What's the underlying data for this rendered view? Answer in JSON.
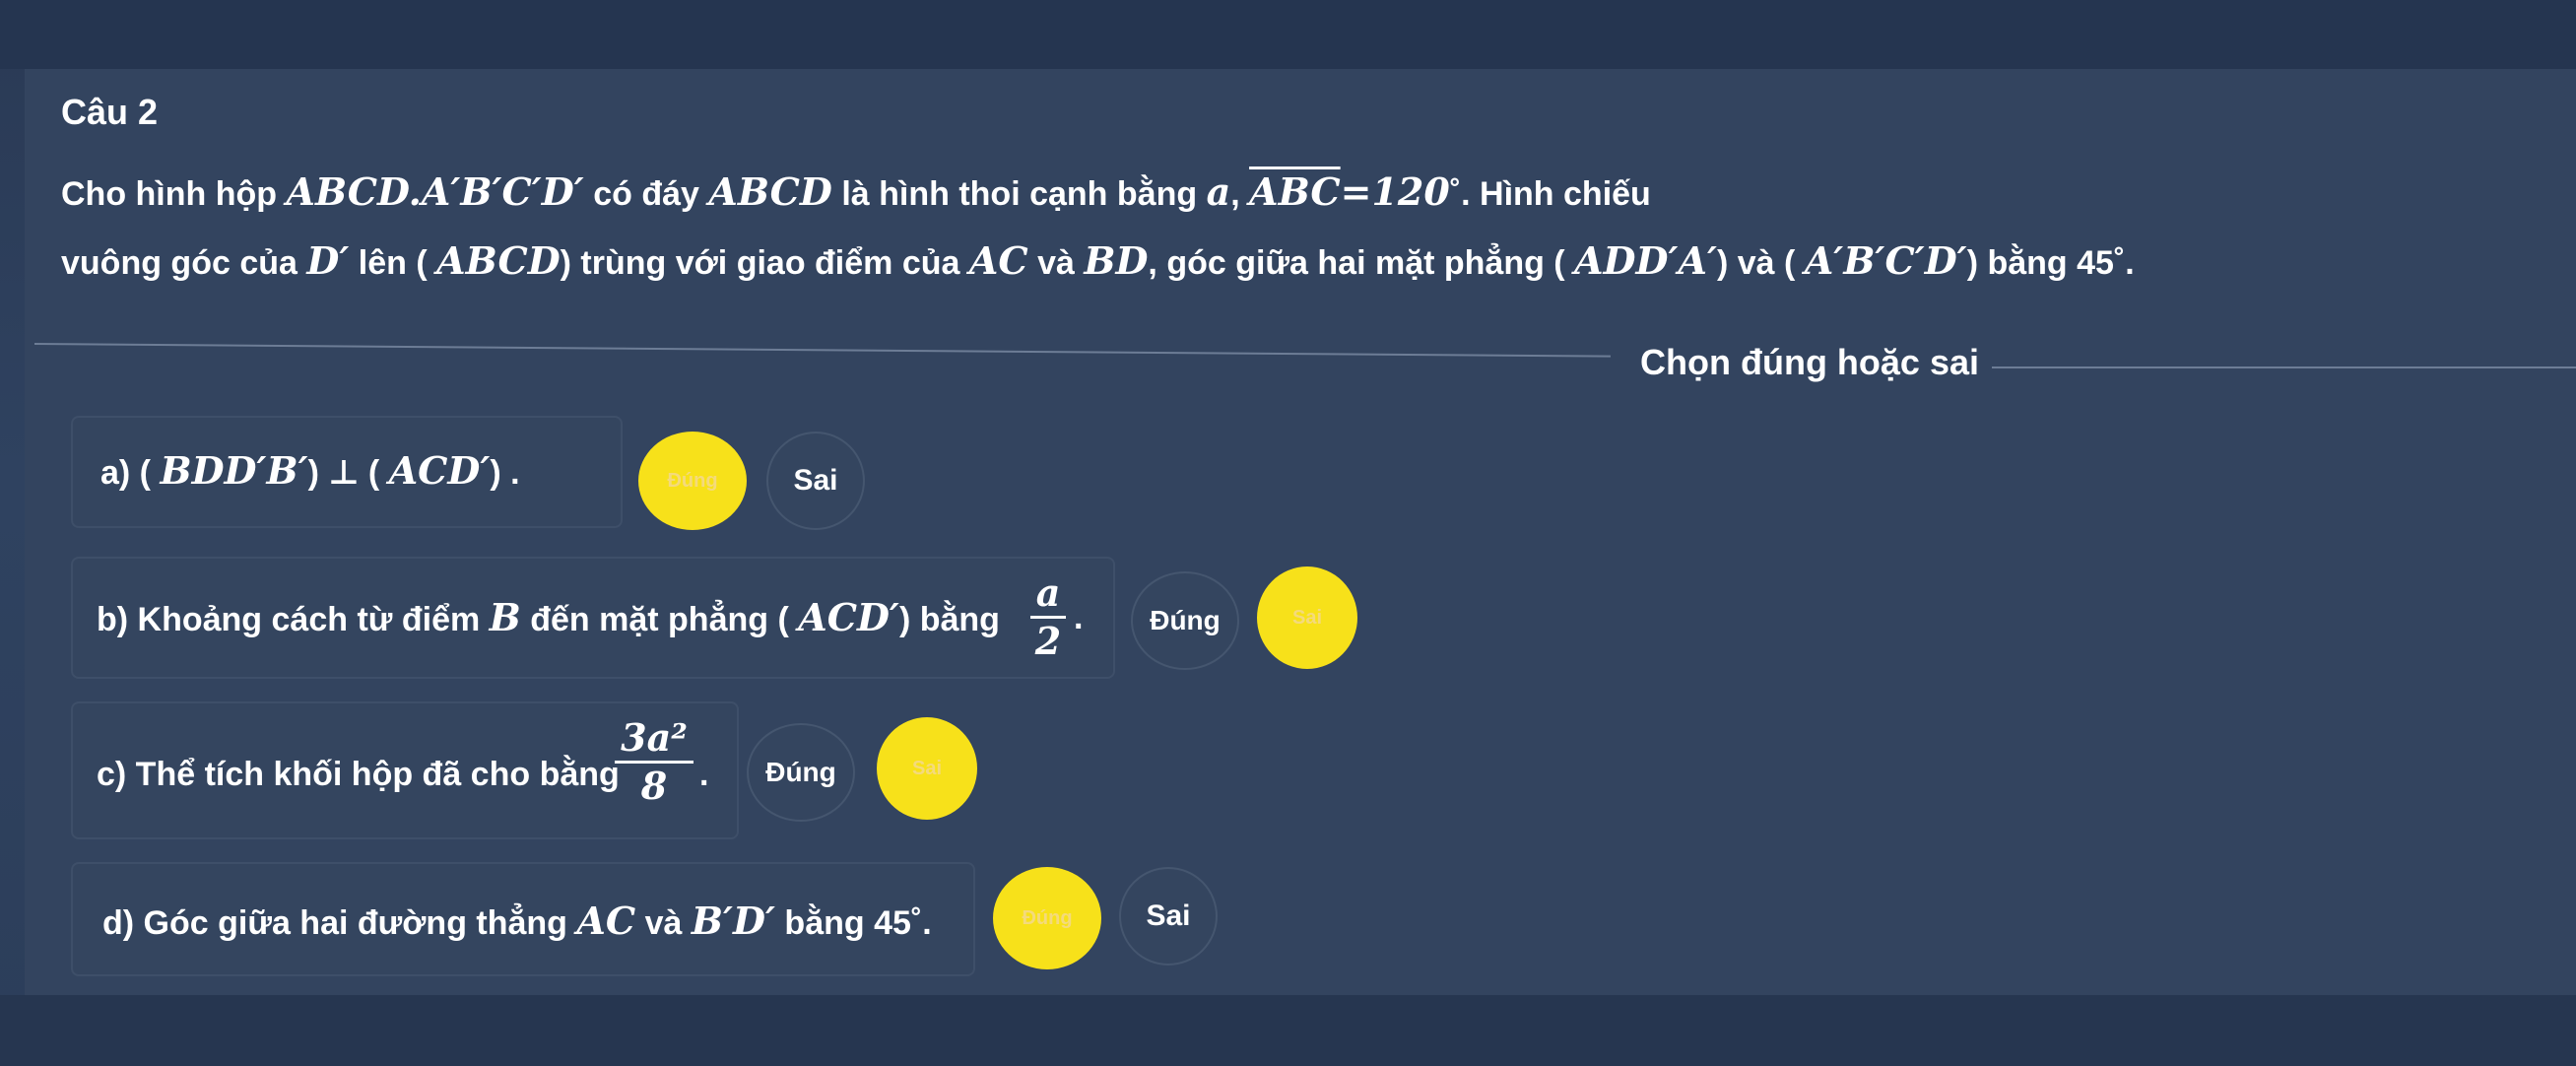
{
  "question": {
    "title": "Câu 2",
    "statement_line1": {
      "t1": "Cho hình hộp ",
      "m1": "ABCD.A′B′C′D′",
      "t2": " có đáy ",
      "m2": "ABCD",
      "t3": " là hình thoi cạnh bằng ",
      "m3": "a",
      "t4": ", ",
      "m4": "ABC",
      "m5": "=120",
      "t5": "˚. Hình chiếu"
    },
    "statement_line2": {
      "t1": "vuông góc của ",
      "m1": "D′",
      "t2": " lên ( ",
      "m2": "ABCD",
      "t3": ") trùng với giao điểm của ",
      "m3": "AC",
      "t4": " và ",
      "m4": "BD",
      "t5": ", góc giữa hai mặt phẳng ( ",
      "m5": "ADD′A′",
      "t6": ") và ( ",
      "m6": "A′B′C′D′",
      "t7": ") bằng 45˚."
    }
  },
  "divider_label": "Chọn đúng hoặc sai",
  "items": [
    {
      "label": "a) ( ",
      "math": "BDD′B′",
      "rest": ") ⊥ ( ",
      "math2": "ACD′",
      "end": ") .",
      "true_label": "Đúng",
      "false_label": "Sai",
      "selected": "true"
    },
    {
      "label": "b) Khoảng cách từ điểm ",
      "math": "B",
      "rest": " đến mặt phẳng ( ",
      "math2": "ACD′",
      "end": ") bằng",
      "frac_num": "a",
      "frac_den": "2",
      "after": ".",
      "true_label": "Đúng",
      "false_label": "Sai",
      "selected": "false"
    },
    {
      "label": "c) Thể tích khối hộp đã cho bằng",
      "frac_num": "3a²",
      "frac_den": "8",
      "after": ".",
      "true_label": "Đúng",
      "false_label": "Sai",
      "selected": "false"
    },
    {
      "label": "d) Góc giữa hai đường thẳng ",
      "math": "AC",
      "rest": " và ",
      "math2": "B′D′",
      "end": " bằng 45˚.",
      "true_label": "Đúng",
      "false_label": "Sai",
      "selected": "true"
    }
  ],
  "colors": {
    "background": "#33445f",
    "selected_button": "#f7e11a",
    "text": "#ffffff"
  }
}
